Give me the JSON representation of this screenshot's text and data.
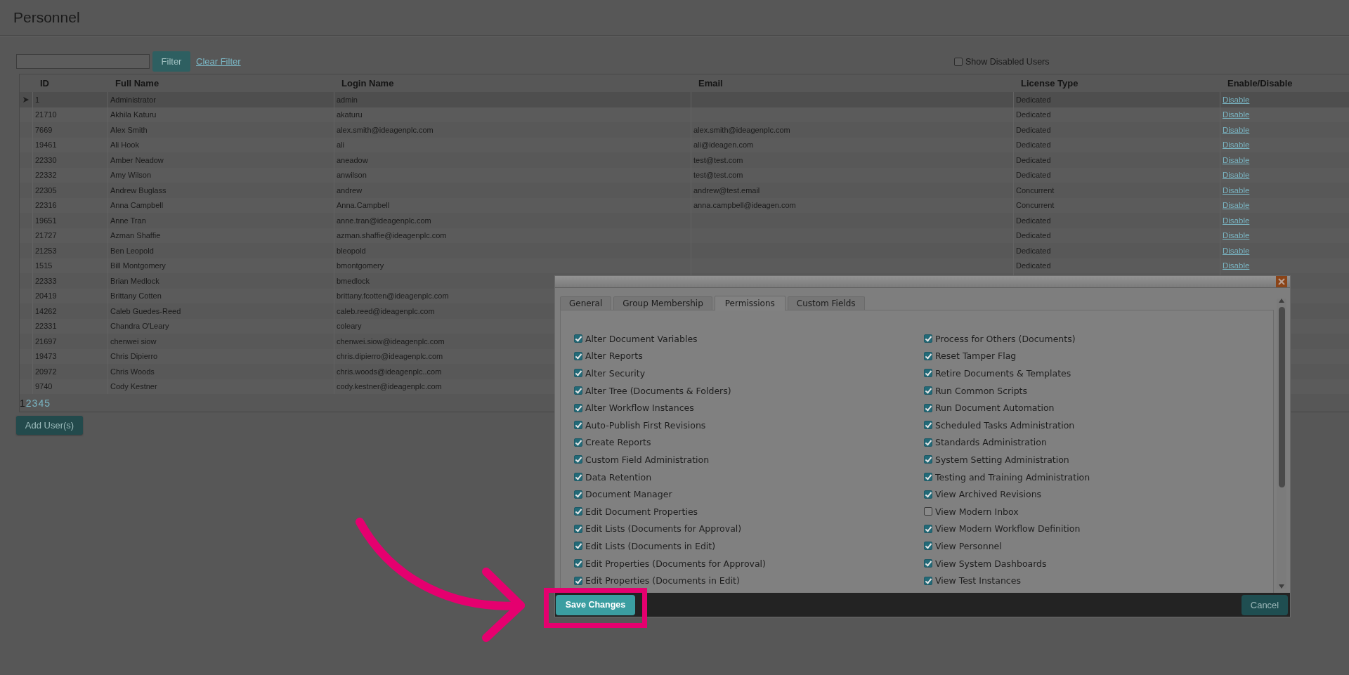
{
  "page": {
    "title": "Personnel"
  },
  "filter": {
    "button": "Filter",
    "clear_link": "Clear Filter"
  },
  "show_disabled_users": {
    "label": "Show Disabled Users",
    "checked": false
  },
  "table": {
    "columns": [
      "ID",
      "Full Name",
      "Login Name",
      "Email",
      "License Type",
      "Enable/Disable"
    ],
    "rows": [
      {
        "selected": true,
        "id": "1",
        "full_name": "Administrator",
        "login_name": "admin",
        "license_type": "Dedicated",
        "action": "Disable"
      },
      {
        "selected": false,
        "id": "21710",
        "full_name": "Akhila Katuru",
        "login_name": "akaturu",
        "license_type": "Dedicated",
        "action": "Disable"
      },
      {
        "selected": false,
        "id": "7669",
        "full_name": "Alex Smith",
        "login_name": "alex.smith@ideagenplc.com",
        "email": "alex.smith@ideagenplc.com",
        "license_type": "Dedicated",
        "action": "Disable"
      },
      {
        "selected": false,
        "id": "19461",
        "full_name": "Ali Hook",
        "login_name": "ali",
        "email": "ali@ideagen.com",
        "license_type": "Dedicated",
        "action": "Disable"
      },
      {
        "selected": false,
        "id": "22330",
        "full_name": "Amber Neadow",
        "login_name": "aneadow",
        "email": "test@test.com",
        "license_type": "Dedicated",
        "action": "Disable"
      },
      {
        "selected": false,
        "id": "22332",
        "full_name": "Amy Wilson",
        "login_name": "anwilson",
        "email": "test@test.com",
        "license_type": "Dedicated",
        "action": "Disable"
      },
      {
        "selected": false,
        "id": "22305",
        "full_name": "Andrew Buglass",
        "login_name": "andrew",
        "email": "andrew@test.email",
        "license_type": "Concurrent",
        "action": "Disable"
      },
      {
        "selected": false,
        "id": "22316",
        "full_name": "Anna Campbell",
        "login_name": "Anna.Campbell",
        "email": "anna.campbell@ideagen.com",
        "license_type": "Concurrent",
        "action": "Disable"
      },
      {
        "selected": false,
        "id": "19651",
        "full_name": "Anne Tran",
        "login_name": "anne.tran@ideagenplc.com",
        "license_type": "Dedicated",
        "action": "Disable"
      },
      {
        "selected": false,
        "id": "21727",
        "full_name": "Azman Shaffie",
        "login_name": "azman.shaffie@ideagenplc.com",
        "license_type": "Dedicated",
        "action": "Disable"
      },
      {
        "selected": false,
        "id": "21253",
        "full_name": "Ben Leopold",
        "login_name": "bleopold",
        "license_type": "Dedicated",
        "action": "Disable"
      },
      {
        "selected": false,
        "id": "1515",
        "full_name": "Bill Montgomery",
        "login_name": "bmontgomery",
        "license_type": "Dedicated",
        "action": "Disable"
      },
      {
        "selected": false,
        "id": "22333",
        "full_name": "Brian Medlock",
        "login_name": "bmedlock"
      },
      {
        "selected": false,
        "id": "20419",
        "full_name": "Brittany Cotten",
        "login_name": "brittany.fcotten@ideagenplc.com"
      },
      {
        "selected": false,
        "id": "14262",
        "full_name": "Caleb Guedes-Reed",
        "login_name": "caleb.reed@ideagenplc.com"
      },
      {
        "selected": false,
        "id": "22331",
        "full_name": "Chandra O'Leary",
        "login_name": "coleary"
      },
      {
        "selected": false,
        "id": "21697",
        "full_name": "chenwei siow",
        "login_name": "chenwei.siow@ideagenplc.com"
      },
      {
        "selected": false,
        "id": "19473",
        "full_name": "Chris Dipierro",
        "login_name": "chris.dipierro@ideagenplc.com"
      },
      {
        "selected": false,
        "id": "20972",
        "full_name": "Chris Woods",
        "login_name": "chris.woods@ideagenplc..com"
      },
      {
        "selected": false,
        "id": "9740",
        "full_name": "Cody Kestner",
        "login_name": "cody.kestner@ideagenplc.com"
      }
    ]
  },
  "pagination": [
    {
      "label": "1",
      "selected": true
    },
    {
      "label": "2",
      "selected": false
    },
    {
      "label": "3",
      "selected": false
    },
    {
      "label": "4",
      "selected": false
    },
    {
      "label": "5",
      "selected": false
    }
  ],
  "add_button": "Add User(s)",
  "dialog": {
    "tabs": [
      {
        "label": "General",
        "selected": false
      },
      {
        "label": "Group Membership",
        "selected": false
      },
      {
        "label": "Permissions",
        "selected": true
      },
      {
        "label": "Custom Fields",
        "selected": false
      }
    ],
    "permission_columns": [
      {
        "items": [
          {
            "label": "Alter Document Variables",
            "checked": true
          },
          {
            "label": "Alter Reports",
            "checked": true
          },
          {
            "label": "Alter Security",
            "checked": true
          },
          {
            "label": "Alter Tree (Documents & Folders)",
            "checked": true
          },
          {
            "label": "Alter Workflow Instances",
            "checked": true
          },
          {
            "label": "Auto-Publish First Revisions",
            "checked": true
          },
          {
            "label": "Create Reports",
            "checked": true
          },
          {
            "label": "Custom Field Administration",
            "checked": true
          },
          {
            "label": "Data Retention",
            "checked": true
          },
          {
            "label": "Document Manager",
            "checked": true
          },
          {
            "label": "Edit Document Properties",
            "checked": true
          },
          {
            "label": "Edit Lists (Documents for Approval)",
            "checked": true
          },
          {
            "label": "Edit Lists (Documents in Edit)",
            "checked": true
          },
          {
            "label": "Edit Properties (Documents for Approval)",
            "checked": true
          },
          {
            "label": "Edit Properties (Documents in Edit)",
            "checked": true
          }
        ]
      },
      {
        "items": [
          {
            "label": "Process for Others (Documents)",
            "checked": true
          },
          {
            "label": "Reset Tamper Flag",
            "checked": true
          },
          {
            "label": "Retire Documents & Templates",
            "checked": true
          },
          {
            "label": "Run Common Scripts",
            "checked": true
          },
          {
            "label": "Run Document Automation",
            "checked": true
          },
          {
            "label": "Scheduled Tasks Administration",
            "checked": true
          },
          {
            "label": "Standards Administration",
            "checked": true
          },
          {
            "label": "System Setting Administration",
            "checked": true
          },
          {
            "label": "Testing and Training Administration",
            "checked": true
          },
          {
            "label": "View Archived Revisions",
            "checked": true
          },
          {
            "label": "View Modern Inbox",
            "checked": false
          },
          {
            "label": "View Modern Workflow Definition",
            "checked": true
          },
          {
            "label": "View Personnel",
            "checked": true
          },
          {
            "label": "View System Dashboards",
            "checked": true
          },
          {
            "label": "View Test Instances",
            "checked": true
          }
        ]
      }
    ],
    "save_button": "Save Changes",
    "cancel_button": "Cancel"
  }
}
